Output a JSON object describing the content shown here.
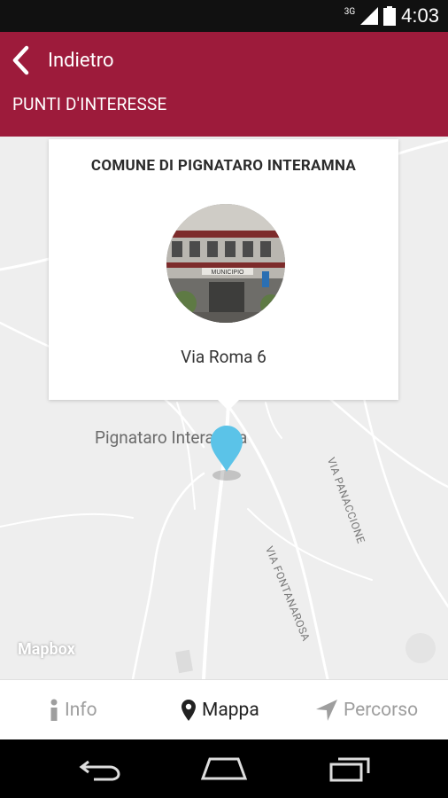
{
  "status_bar": {
    "time": "4:03",
    "network": "3G"
  },
  "header": {
    "back_label": "Indietro",
    "section_title": "PUNTI D'INTERESSE"
  },
  "map": {
    "place_label": "Pignataro Interamna",
    "roads": [
      "VIA PANACCIONE",
      "VIA FONTANAROSA"
    ],
    "attribution": "Mapbox"
  },
  "popup": {
    "title": "COMUNE DI PIGNATARO INTERAMNA",
    "address": "Via Roma 6",
    "photo_sign": "MUNICIPIO"
  },
  "tabs": [
    {
      "label": "Info",
      "icon": "info-icon",
      "active": false
    },
    {
      "label": "Mappa",
      "icon": "map-marker-icon",
      "active": true
    },
    {
      "label": "Percorso",
      "icon": "navigation-arrow-icon",
      "active": false
    }
  ],
  "colors": {
    "brand": "#9d1b3b",
    "pin": "#5bc3e8",
    "tab_active": "#222222",
    "tab_inactive": "#9e9e9e"
  }
}
